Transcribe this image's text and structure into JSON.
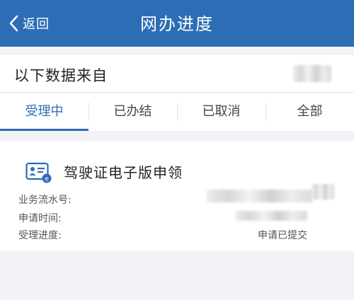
{
  "nav": {
    "back_label": "返回",
    "title": "网办进度",
    "color": "#2d6db5"
  },
  "source": {
    "label": "以下数据来自"
  },
  "tabs": [
    {
      "label": "受理中",
      "active": true
    },
    {
      "label": "已办结",
      "active": false
    },
    {
      "label": "已取消",
      "active": false
    },
    {
      "label": "全部",
      "active": false
    }
  ],
  "card": {
    "icon": "id-card-icon",
    "title": "驾驶证电子版申领",
    "rows": [
      {
        "label": "业务流水号:",
        "value": ""
      },
      {
        "label": "申请时间:",
        "value": ""
      },
      {
        "label": "受理进度:",
        "value": "申请已提交"
      }
    ]
  }
}
